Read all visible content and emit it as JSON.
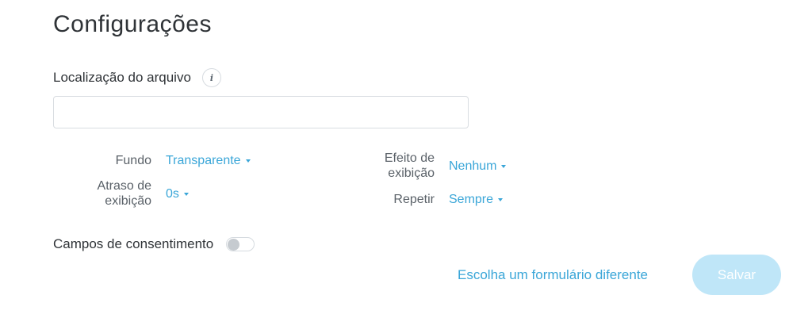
{
  "page": {
    "title": "Configurações"
  },
  "file": {
    "label": "Localização do arquivo",
    "info_icon": "i",
    "value": "",
    "placeholder": ""
  },
  "options": {
    "background": {
      "label": "Fundo",
      "value": "Transparente"
    },
    "delay": {
      "label_line1": "Atraso de",
      "label_line2": "exibição",
      "value": "0s"
    },
    "effect": {
      "label_line1": "Efeito de",
      "label_line2": "exibição",
      "value": "Nenhum"
    },
    "repeat": {
      "label": "Repetir",
      "value": "Sempre"
    }
  },
  "consent": {
    "label": "Campos de consentimento",
    "enabled": false
  },
  "actions": {
    "choose_form": "Escolha um formulário diferente",
    "save": "Salvar"
  },
  "colors": {
    "accent": "#3aa6d8",
    "save_disabled": "#bfe6f8"
  }
}
